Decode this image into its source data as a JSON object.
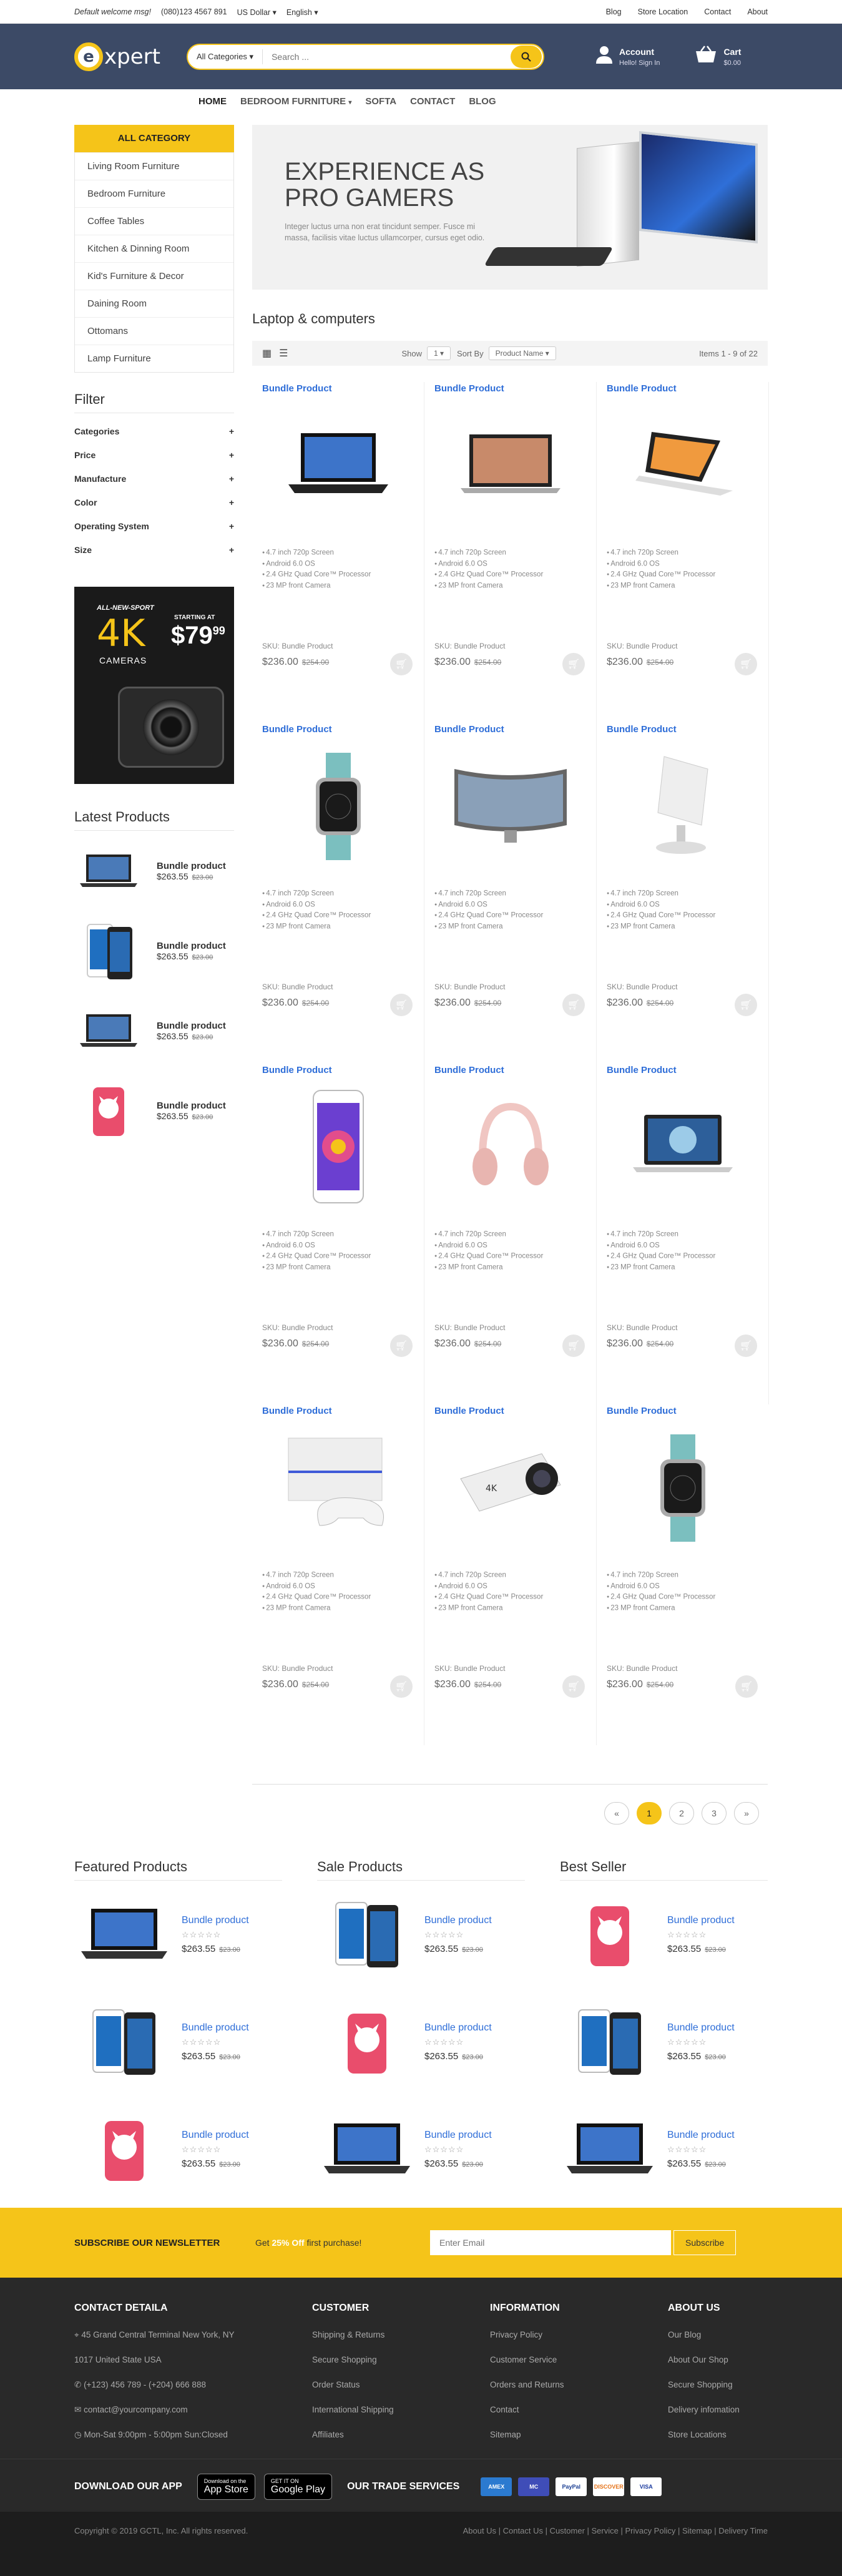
{
  "topbar": {
    "welcome": "Default welcome msg!",
    "phone": "(080)123 4567 891",
    "currency": "US Dollar",
    "language": "English",
    "links": [
      "Blog",
      "Store Location",
      "Contact",
      "About"
    ]
  },
  "header": {
    "logo_letter": "e",
    "logo_text": "xpert",
    "search_category": "All Categories",
    "search_placeholder": "Search ...",
    "account_title": "Account",
    "account_sub": "Hello! Sign In",
    "cart_title": "Cart",
    "cart_total": "$0.00"
  },
  "nav": [
    "HOME",
    "BEDROOM FURNITURE",
    "SOFTA",
    "CONTACT",
    "BLOG"
  ],
  "sidebar": {
    "category_title": "ALL CATEGORY",
    "categories": [
      "Living Room Furniture",
      "Bedroom Furniture",
      "Coffee Tables",
      "Kitchen & Dinning Room",
      "Kid's Furniture & Decor",
      "Daining Room",
      "Ottomans",
      "Lamp Furniture"
    ],
    "filter_title": "Filter",
    "filters": [
      "Categories",
      "Price",
      "Manufacture",
      "Color",
      "Operating System",
      "Size"
    ],
    "promo": {
      "line1": "ALL-NEW-SPORT",
      "big": "4K",
      "sub": "CAMERAS",
      "starting": "STARTING AT",
      "price": "$79",
      "cents": "99"
    },
    "latest_title": "Latest Products",
    "latest": [
      {
        "name": "Bundle product",
        "price": "$263.55",
        "old": "$23.00"
      },
      {
        "name": "Bundle product",
        "price": "$263.55",
        "old": "$23.00"
      },
      {
        "name": "Bundle product",
        "price": "$263.55",
        "old": "$23.00"
      },
      {
        "name": "Bundle product",
        "price": "$263.55",
        "old": "$23.00"
      }
    ]
  },
  "banner": {
    "title": "EXPERIENCE AS PRO GAMERS",
    "text": "Integer luctus urna non erat tincidunt semper. Fusce mi massa, facilisis vitae luctus ullamcorper, cursus eget odio."
  },
  "section_title": "Laptop & computers",
  "toolbar": {
    "show_label": "Show",
    "show_value": "1",
    "sort_label": "Sort By",
    "sort_value": "Product Name",
    "items": "Items 1 - 9 of 22"
  },
  "product_common": {
    "title": "Bundle Product",
    "features": [
      "4.7 inch 720p Screen",
      "Android 6.0 OS",
      "2.4 GHz Quad Core™ Processor",
      "23 MP front Camera"
    ],
    "sku": "SKU: Bundle Product",
    "price": "$236.00",
    "old": "$254.00"
  },
  "pagination": [
    "«",
    "1",
    "2",
    "3",
    "»"
  ],
  "featured": [
    {
      "title": "Featured Products",
      "items": [
        {
          "name": "Bundle product",
          "stars": "☆☆☆☆☆",
          "price": "$263.55",
          "old": "$23.00"
        },
        {
          "name": "Bundle product",
          "stars": "☆☆☆☆☆",
          "price": "$263.55",
          "old": "$23.00"
        },
        {
          "name": "Bundle product",
          "stars": "☆☆☆☆☆",
          "price": "$263.55",
          "old": "$23.00"
        }
      ]
    },
    {
      "title": "Sale Products",
      "items": [
        {
          "name": "Bundle product",
          "stars": "☆☆☆☆☆",
          "price": "$263.55",
          "old": "$23.00"
        },
        {
          "name": "Bundle product",
          "stars": "☆☆☆☆☆",
          "price": "$263.55",
          "old": "$23.00"
        },
        {
          "name": "Bundle product",
          "stars": "☆☆☆☆☆",
          "price": "$263.55",
          "old": "$23.00"
        }
      ]
    },
    {
      "title": "Best Seller",
      "items": [
        {
          "name": "Bundle product",
          "stars": "☆☆☆☆☆",
          "price": "$263.55",
          "old": "$23.00"
        },
        {
          "name": "Bundle product",
          "stars": "☆☆☆☆☆",
          "price": "$263.55",
          "old": "$23.00"
        },
        {
          "name": "Bundle product",
          "stars": "☆☆☆☆☆",
          "price": "$263.55",
          "old": "$23.00"
        }
      ]
    }
  ],
  "newsletter": {
    "title": "SUBSCRIBE OUR NEWSLETTER",
    "get": "Get ",
    "off": "25% Off",
    "rest": " first purchase!",
    "placeholder": "Enter Email",
    "button": "Subscribe"
  },
  "footer": {
    "contact_title": "CONTACT DETAILA",
    "contact": [
      "45 Grand Central Terminal New York, NY",
      "1017 United State USA",
      "(+123) 456 789 - (+204) 666 888",
      "contact@yourcompany.com",
      "Mon-Sat 9:00pm - 5:00pm Sun:Closed"
    ],
    "customer_title": "CUSTOMER",
    "customer": [
      "Shipping & Returns",
      "Secure Shopping",
      "Order Status",
      "International Shipping",
      "Affiliates"
    ],
    "info_title": "INFORMATION",
    "info": [
      "Privacy Policy",
      "Customer Service",
      "Orders and Returns",
      "Contact",
      "Sitemap"
    ],
    "about_title": "ABOUT US",
    "about": [
      "Our Blog",
      "About Our Shop",
      "Secure Shopping",
      "Delivery infomation",
      "Store Locations"
    ],
    "app_title": "DOWNLOAD OUR APP",
    "appstore_small": "Download on the",
    "appstore": "App Store",
    "gplay_small": "GET IT ON",
    "gplay": "Google Play",
    "trade_title": "OUR TRADE SERVICES",
    "payments": [
      "AMEX",
      "MC",
      "PayPal",
      "DISCOVER",
      "VISA"
    ]
  },
  "copyright": {
    "text": "Copyright © 2019 GCTL, Inc. All rights reserved.",
    "links": "About Us | Contact Us | Customer | Service | Privacy Policy | Sitemap | Delivery Time"
  },
  "colors": {
    "accent": "#f5c419",
    "header_bg": "#3c4a66",
    "link": "#2f6ed8"
  }
}
